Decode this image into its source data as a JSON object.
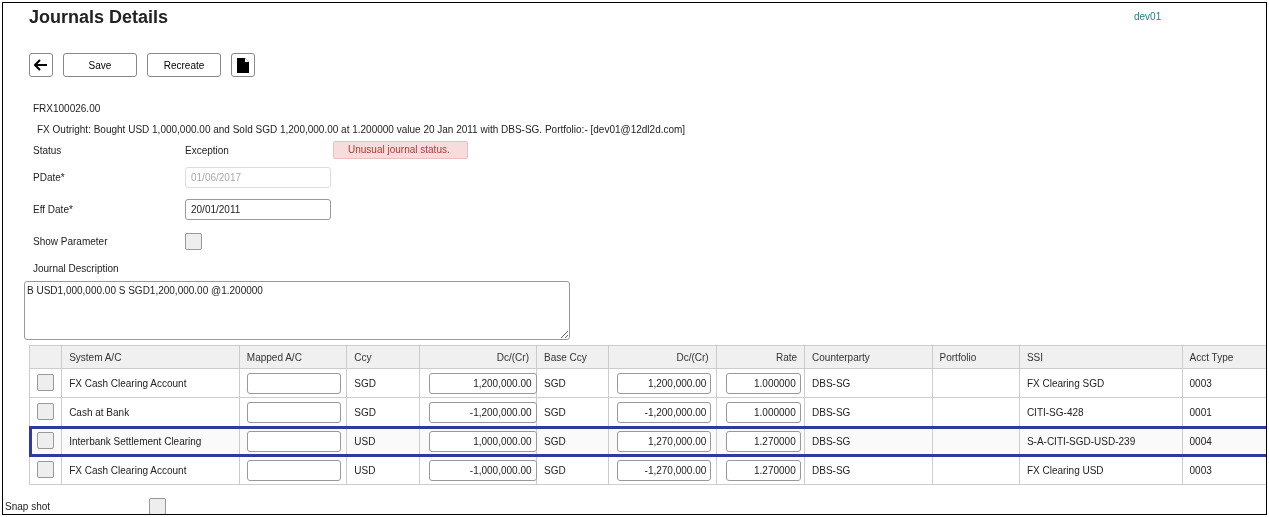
{
  "page": {
    "title": "Journals Details",
    "user": "dev01"
  },
  "toolbar": {
    "buttons": [
      {
        "kind": "back"
      },
      {
        "kind": "text",
        "label": "Save"
      },
      {
        "kind": "text",
        "label": "Recreate"
      },
      {
        "kind": "document"
      }
    ]
  },
  "journal": {
    "reference": "FRX100026.00",
    "summary": "FX Outright: Bought USD 1,000,000.00 and Sold SGD 1,200,000.00 at 1.200000 value 20 Jan 2011 with DBS-SG. Portfolio:- [dev01@12dl2d.com]"
  },
  "status": {
    "label": "Status",
    "value": "Exception",
    "message": "Unusual journal status."
  },
  "fields": [
    {
      "kind": "date",
      "label": "PDate*",
      "value": "01/06/2017",
      "disabled": true
    },
    {
      "kind": "date",
      "label": "Eff Date*",
      "value": "20/01/2011",
      "disabled": false
    },
    {
      "kind": "checkbox",
      "label": "Show Parameter",
      "checked": false
    }
  ],
  "description": {
    "label": "Journal Description",
    "value": "B USD1,000,000.00 S SGD1,200,000.00 @1.200000"
  },
  "table": {
    "columns": [
      "System A/C",
      "Mapped A/C",
      "Ccy",
      "Dc/(Cr)",
      "Base Ccy",
      "Dc/(Cr)",
      "Rate",
      "Counterparty",
      "Portfolio",
      "SSI",
      "Acct Type"
    ],
    "rows": [
      {
        "selected": false,
        "checked": false,
        "system_ac": "FX Cash Clearing Account",
        "ccy": "SGD",
        "dc_cr": "1,200,000.00",
        "base_ccy": "SGD",
        "base_dc_cr": "1,200,000.00",
        "rate": "1.000000",
        "counterparty": "DBS-SG",
        "ssi": "FX Clearing SGD",
        "acct_type": "0003"
      },
      {
        "selected": false,
        "checked": false,
        "system_ac": "Cash at Bank",
        "ccy": "SGD",
        "dc_cr": "-1,200,000.00",
        "base_ccy": "SGD",
        "base_dc_cr": "-1,200,000.00",
        "rate": "1.000000",
        "counterparty": "DBS-SG",
        "ssi": "CITI-SG-428",
        "acct_type": "0001"
      },
      {
        "selected": true,
        "checked": false,
        "system_ac": "Interbank Settlement Clearing",
        "ccy": "USD",
        "dc_cr": "1,000,000.00",
        "base_ccy": "SGD",
        "base_dc_cr": "1,270,000.00",
        "rate": "1.270000",
        "counterparty": "DBS-SG",
        "ssi": "S-A-CITI-SGD-USD-239",
        "acct_type": "0004"
      },
      {
        "selected": false,
        "checked": false,
        "system_ac": "FX Cash Clearing Account",
        "ccy": "USD",
        "dc_cr": "-1,000,000.00",
        "base_ccy": "SGD",
        "base_dc_cr": "-1,270,000.00",
        "rate": "1.270000",
        "counterparty": "DBS-SG",
        "ssi": "FX Clearing USD",
        "acct_type": "0003"
      }
    ]
  },
  "snapshot": {
    "label": "Snap shot",
    "checked": false
  }
}
